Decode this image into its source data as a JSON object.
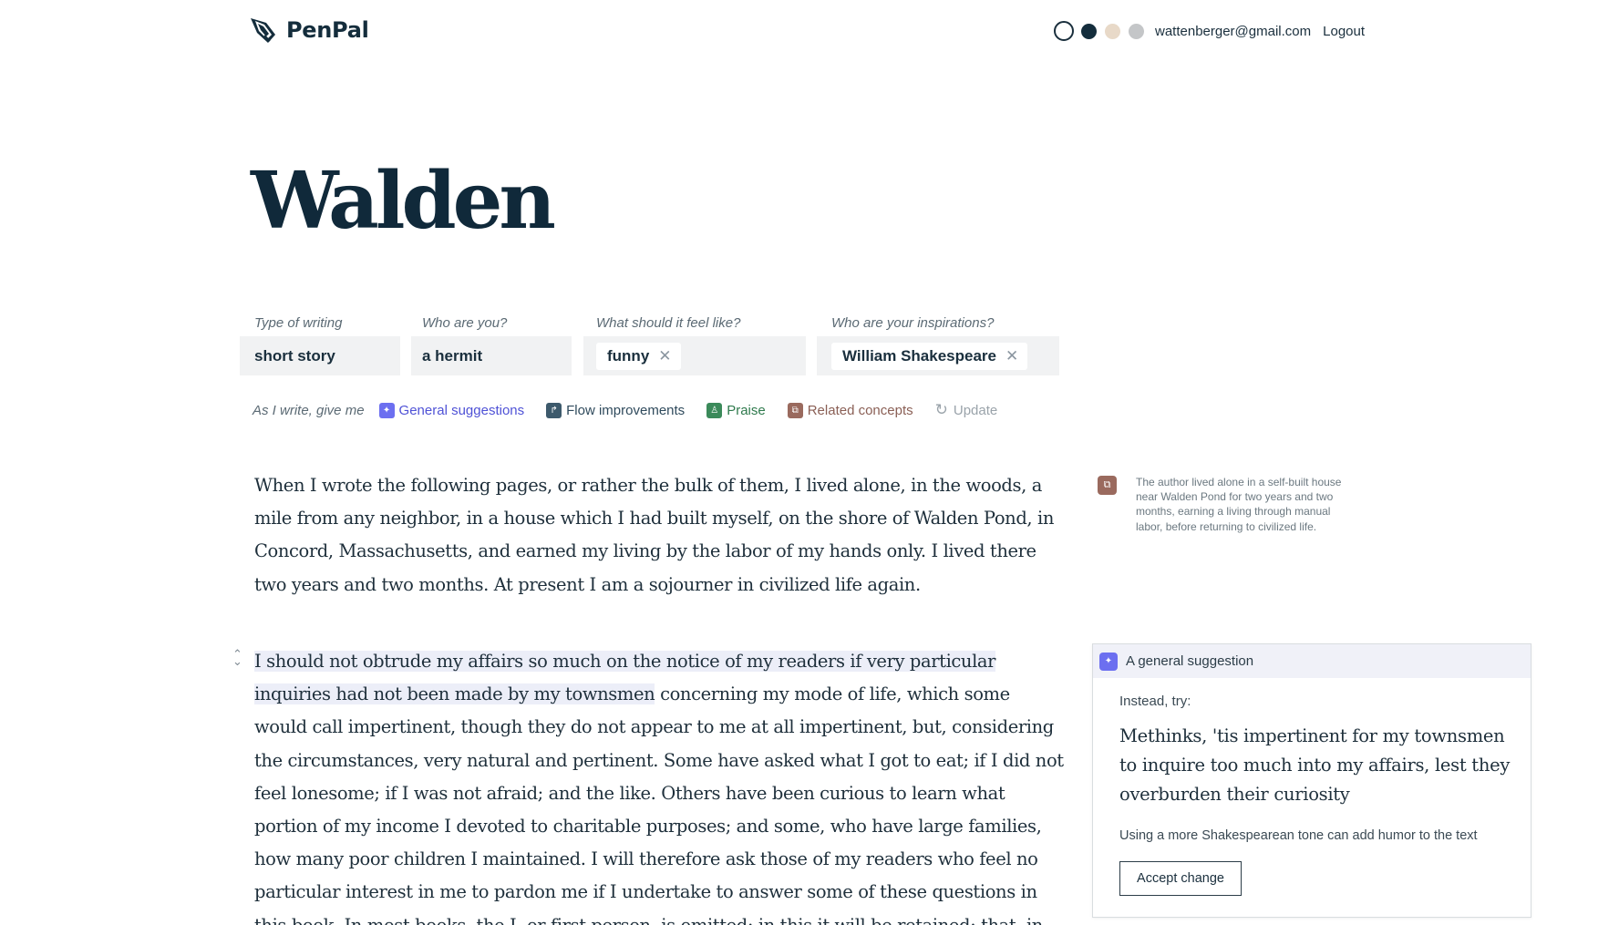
{
  "app": {
    "name": "PenPal",
    "user_email": "wattenberger@gmail.com",
    "logout_label": "Logout",
    "theme_colors": [
      "#ffffff",
      "#142d3c",
      "#e8d9c8",
      "#c4c6c8"
    ]
  },
  "document": {
    "title": "Walden"
  },
  "fields": {
    "type": {
      "label": "Type of writing",
      "value": "short story"
    },
    "who": {
      "label": "Who are you?",
      "value": "a hermit"
    },
    "feel": {
      "label": "What should it feel like?",
      "chips": [
        "funny"
      ]
    },
    "inspirations": {
      "label": "Who are your inspirations?",
      "chips": [
        "William Shakespeare"
      ]
    }
  },
  "feedback_options": {
    "label": "As I write, give me",
    "items": [
      {
        "label": "General suggestions",
        "icon": "sparkle-icon",
        "color": "#5b5ee0"
      },
      {
        "label": "Flow improvements",
        "icon": "flow-arrow-icon",
        "color": "#3d5a6c"
      },
      {
        "label": "Praise",
        "icon": "praise-icon",
        "color": "#3b8a5a"
      },
      {
        "label": "Related concepts",
        "icon": "external-link-icon",
        "color": "#9a6a5e"
      }
    ],
    "update_label": "Update"
  },
  "body": {
    "paragraph1": "When I wrote the following pages, or rather the bulk of them, I lived alone, in the woods, a mile from any neighbor, in a house which I had built myself, on the shore of Walden Pond, in Concord, Massachusetts, and earned my living by the labor of my hands only. I lived there two years and two months. At present I am a sojourner in civilized life again.",
    "paragraph2_highlight": "I should not obtrude my affairs so much on the notice of my readers if very particular inquiries had not been made by my townsmen",
    "paragraph2_rest": " concerning my mode of life, which some would call impertinent, though they do not appear to me at all impertinent, but, considering the circumstances, very natural and pertinent. Some have asked what I got to eat; if I did not feel lonesome; if I was not afraid; and the like. Others have been curious to learn what portion of my income I devoted to charitable purposes; and some, who have large families, how many poor children I maintained. I will therefore ask those of my readers who feel no particular interest in me to pardon me if I undertake to answer some of these questions in this book. In most books, the I, or first person, is omitted; in this it will be retained; that, in respect to egotism, is the main difference. We commonly do not remember that it"
  },
  "side_note": {
    "icon": "external-link-icon",
    "text": "The author lived alone in a self-built house near Walden Pond for two years and two months, earning a living through manual labor, before returning to civilized life."
  },
  "suggestion": {
    "title": "A general suggestion",
    "instead_label": "Instead, try:",
    "text": "Methinks, 'tis impertinent for my townsmen to inquire too much into my affairs, lest they overburden their curiosity",
    "reason": "Using a more Shakespearean tone can add humor to the text",
    "accept_label": "Accept change"
  }
}
